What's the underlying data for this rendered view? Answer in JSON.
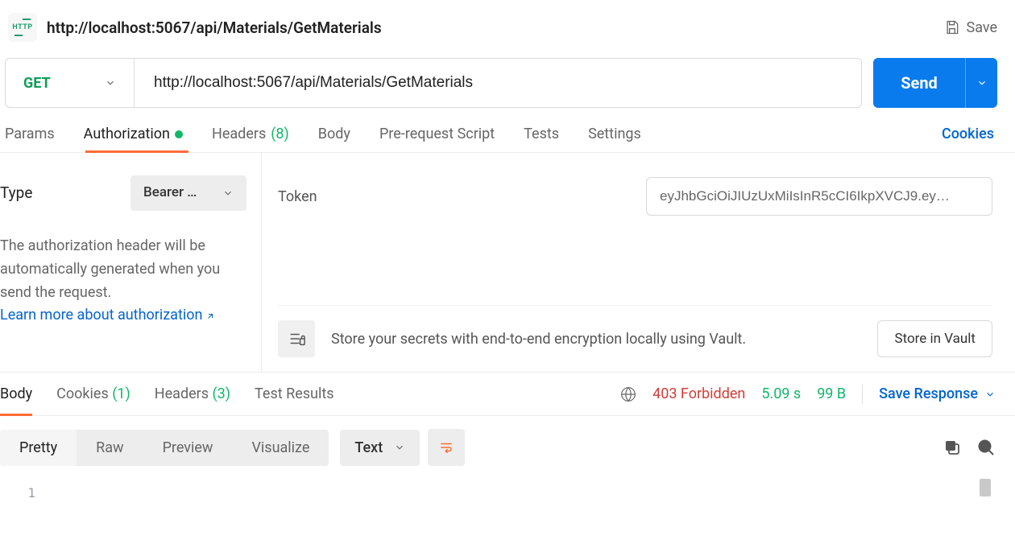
{
  "header": {
    "title": "http://localhost:5067/api/Materials/GetMaterials",
    "save_label": "Save"
  },
  "request": {
    "method": "GET",
    "url": "http://localhost:5067/api/Materials/GetMaterials",
    "send_label": "Send"
  },
  "req_tabs": {
    "params": "Params",
    "authorization": "Authorization",
    "headers": "Headers",
    "headers_count": "(8)",
    "body": "Body",
    "prerequest": "Pre-request Script",
    "tests": "Tests",
    "settings": "Settings",
    "cookies": "Cookies"
  },
  "auth": {
    "type_label": "Type",
    "type_value": "Bearer …",
    "help_text": "The authorization header will be automatically generated when you send the request.",
    "learn_link": "Learn more about authorization",
    "token_label": "Token",
    "token_value": "eyJhbGciOiJIUzUxMiIsInR5cCI6IkpXVCJ9.ey…"
  },
  "vault": {
    "text": "Store your secrets with end-to-end encryption locally using Vault.",
    "button": "Store in Vault"
  },
  "resp_tabs": {
    "body": "Body",
    "cookies": "Cookies",
    "cookies_count": "(1)",
    "headers": "Headers",
    "headers_count": "(3)",
    "test_results": "Test Results"
  },
  "response": {
    "status": "403 Forbidden",
    "time": "5.09 s",
    "size": "99 B",
    "save_response": "Save Response"
  },
  "view": {
    "pretty": "Pretty",
    "raw": "Raw",
    "preview": "Preview",
    "visualize": "Visualize",
    "format": "Text"
  },
  "body_lines": [
    "1"
  ],
  "body_content": [
    ""
  ]
}
